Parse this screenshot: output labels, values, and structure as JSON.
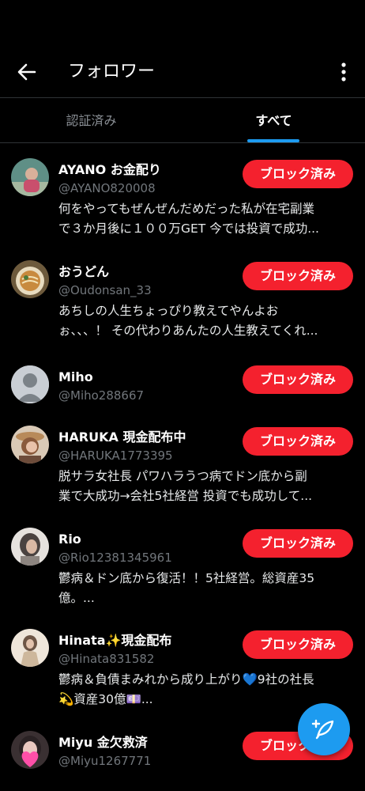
{
  "header": {
    "title": "フォロワー",
    "back_icon": "arrow-left-icon",
    "more_icon": "more-vertical-icon"
  },
  "tabs": [
    {
      "label": "認証済み",
      "active": false
    },
    {
      "label": "すべて",
      "active": true
    }
  ],
  "colors": {
    "background": "#000000",
    "accent": "#1d9bf0",
    "block_button": "#f4212e",
    "handle": "#71767b",
    "divider": "#2f3336"
  },
  "followers": [
    {
      "name": "AYANO お金配り",
      "handle": "@AYANO820008",
      "bio_lines": [
        "何をやってもぜんぜんだめだった私が在宅副業",
        "で３か月後に１００万GET 今では投資で成功..."
      ],
      "button": "ブロック済み"
    },
    {
      "name": "おうどん",
      "handle": "@Oudonsan_33",
      "bio_lines": [
        "あちしの人生ちょっぴり教えてやんよお",
        "ぉ、、、！ その代わりあんたの人生教えてくれ..."
      ],
      "button": "ブロック済み"
    },
    {
      "name": "Miho",
      "handle": "@Miho288667",
      "bio_lines": [],
      "button": "ブロック済み"
    },
    {
      "name": "HARUKA 現金配布中",
      "handle": "@HARUKA1773395",
      "bio_lines": [
        "脱サラ女社長 パワハラうつ病でドン底から副",
        "業で大成功→会社5社経営 投資でも成功して..."
      ],
      "button": "ブロック済み"
    },
    {
      "name": "Rio",
      "handle": "@Rio12381345961",
      "bio_lines": [
        "鬱病＆ドン底から復活！！5社経営。総資産35",
        "億。..."
      ],
      "button": "ブロック済み"
    },
    {
      "name": "Hinata✨現金配布",
      "handle": "@Hinata831582",
      "bio_lines": [
        "鬱病＆負債まみれから成り上がり💙9社の社長",
        "💫資産30億💷..."
      ],
      "button": "ブロック済み"
    },
    {
      "name": "Miyu 金欠救済",
      "handle": "@Miyu1267771",
      "bio_lines": [],
      "button": "ブロック済み"
    }
  ],
  "fab_icon": "compose-tweet-icon"
}
